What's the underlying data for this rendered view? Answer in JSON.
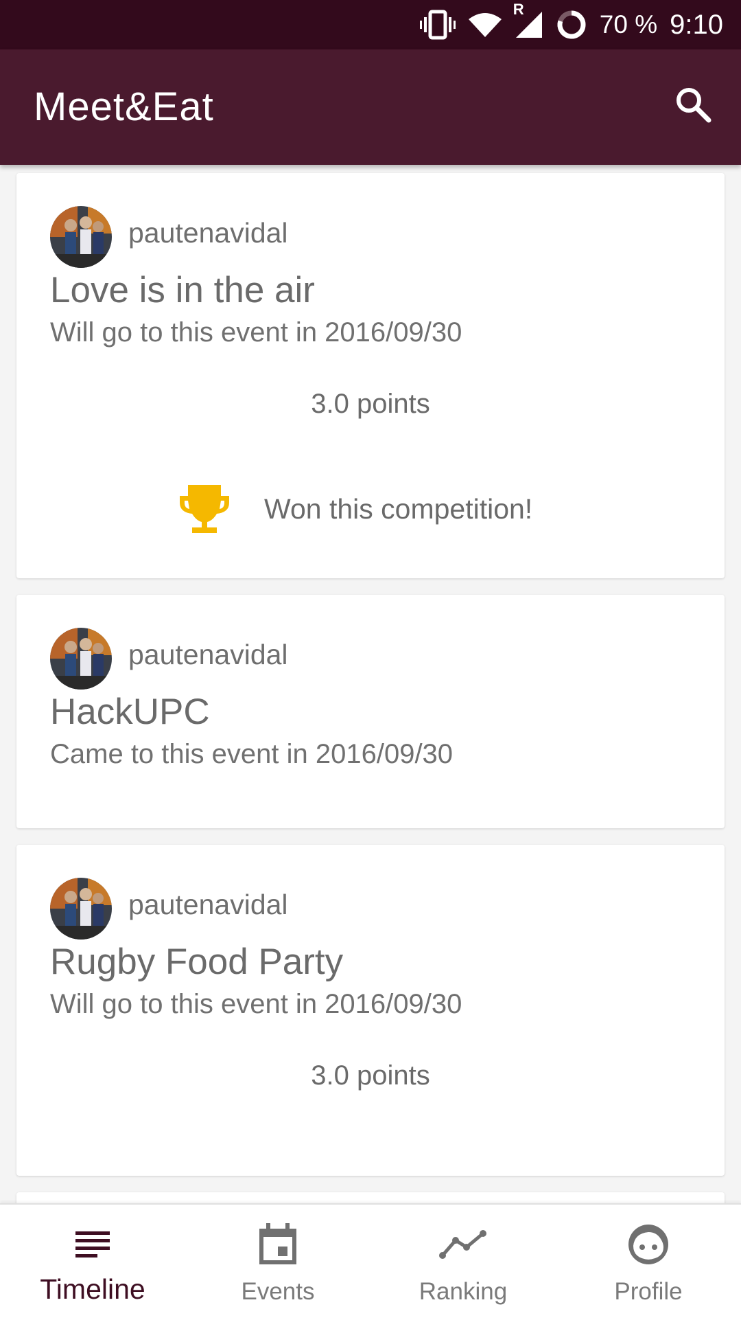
{
  "status_bar": {
    "battery": "70 %",
    "time": "9:10",
    "network_label": "R"
  },
  "app_bar": {
    "title": "Meet&Eat",
    "search_icon": "search-icon"
  },
  "colors": {
    "status_bar": "#330a1c",
    "app_bar": "#4a1a2e",
    "accent": "#3e0e22",
    "trophy": "#f5b800"
  },
  "feed": [
    {
      "username": "pautenavidal",
      "title": "Love is in the air",
      "subtitle": "Will go to this event in 2016/09/30",
      "points": "3.0 points",
      "won_text": "Won this competition!"
    },
    {
      "username": "pautenavidal",
      "title": "HackUPC",
      "subtitle": "Came to this event in 2016/09/30"
    },
    {
      "username": "pautenavidal",
      "title": "Rugby Food Party",
      "subtitle": "Will go to this event in 2016/09/30",
      "points": "3.0 points"
    }
  ],
  "bottom_nav": [
    {
      "label": "Timeline",
      "icon": "list-icon",
      "active": true
    },
    {
      "label": "Events",
      "icon": "calendar-icon",
      "active": false
    },
    {
      "label": "Ranking",
      "icon": "trending-icon",
      "active": false
    },
    {
      "label": "Profile",
      "icon": "face-icon",
      "active": false
    }
  ]
}
